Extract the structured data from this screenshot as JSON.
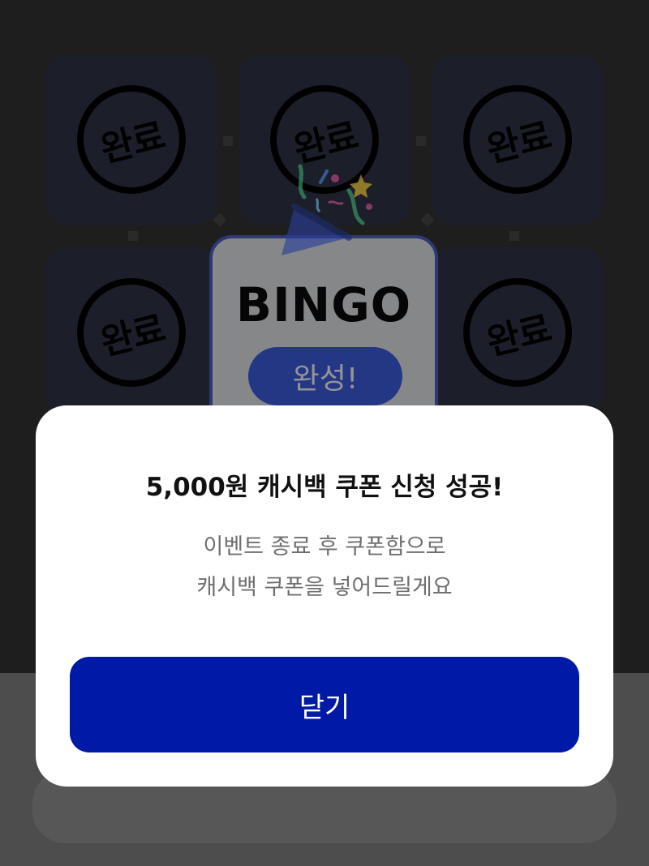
{
  "board": {
    "stamp_label": "완료",
    "center_title": "BINGO",
    "center_badge": "완성!"
  },
  "modal": {
    "title": "5,000원 캐시백 쿠폰 신청 성공!",
    "description_line1": "이벤트 종료 후 쿠폰함으로",
    "description_line2": "캐시백 쿠폰을 넣어드릴게요",
    "close_label": "닫기"
  },
  "colors": {
    "primary_button": "#0019a6",
    "bingo_accent": "#3c5ee6",
    "overlay": "#1e1e1e"
  },
  "icons": [
    "party-popper-icon"
  ]
}
